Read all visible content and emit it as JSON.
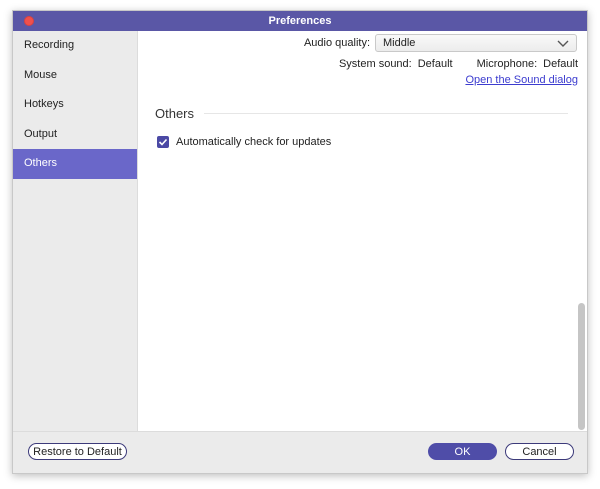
{
  "window": {
    "title": "Preferences"
  },
  "sidebar": {
    "items": [
      {
        "label": "Recording"
      },
      {
        "label": "Mouse"
      },
      {
        "label": "Hotkeys"
      },
      {
        "label": "Output"
      },
      {
        "label": "Others"
      }
    ],
    "active": "Others"
  },
  "audio": {
    "quality_label": "Audio quality:",
    "quality_value": "Middle",
    "system_sound_label": "System sound:",
    "system_sound_value": "Default",
    "microphone_label": "Microphone:",
    "microphone_value": "Default",
    "sound_dialog_link": "Open the Sound dialog"
  },
  "others": {
    "section_title": "Others",
    "auto_update_label": "Automatically check for updates",
    "auto_update_checked": true
  },
  "footer": {
    "restore_label": "Restore to Default",
    "ok_label": "OK",
    "cancel_label": "Cancel"
  },
  "colors": {
    "accent": "#5a57a6",
    "sidebar_active": "#6a67c9",
    "close_button": "#f0504c",
    "link": "#3c3ccf"
  }
}
